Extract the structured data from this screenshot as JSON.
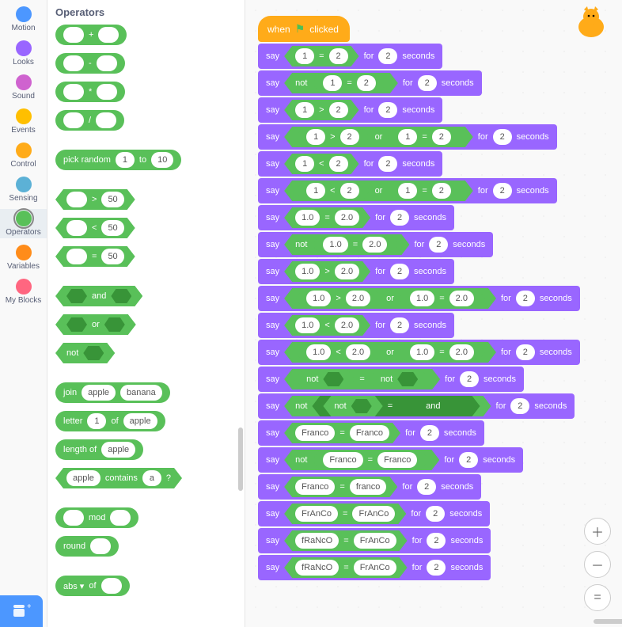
{
  "categories": [
    {
      "name": "Motion",
      "color": "#4c97ff"
    },
    {
      "name": "Looks",
      "color": "#9966ff"
    },
    {
      "name": "Sound",
      "color": "#cf63cf"
    },
    {
      "name": "Events",
      "color": "#ffbf00"
    },
    {
      "name": "Control",
      "color": "#ffab19"
    },
    {
      "name": "Sensing",
      "color": "#5cb1d6"
    },
    {
      "name": "Operators",
      "color": "#59c059",
      "selected": true
    },
    {
      "name": "Variables",
      "color": "#ff8c1a"
    },
    {
      "name": "My Blocks",
      "color": "#ff6680"
    }
  ],
  "palette_title": "Operators",
  "symbols": {
    "plus": "+",
    "minus": "-",
    "times": "*",
    "div": "/",
    "gt": ">",
    "lt": "<",
    "eq": "="
  },
  "palette": {
    "pick_random": "pick random",
    "to": "to",
    "rand_a": "1",
    "rand_b": "10",
    "cmp_val": "50",
    "and": "and",
    "or": "or",
    "not": "not",
    "join": "join",
    "j_a": "apple",
    "j_b": "banana",
    "letter": "letter",
    "let_n": "1",
    "of": "of",
    "let_s": "apple",
    "length_of": "length of",
    "len_s": "apple",
    "contains": "contains",
    "cont_s": "apple",
    "cont_c": "a",
    "q": "?",
    "mod": "mod",
    "round": "round",
    "abs": "abs ▾"
  },
  "hat": {
    "when": "when",
    "clicked": "clicked"
  },
  "say": "say",
  "for": "for",
  "seconds": "seconds",
  "secs": "2",
  "rows": [
    {
      "kind": "eq",
      "a": "1",
      "b": "2"
    },
    {
      "kind": "noteq",
      "a": "1",
      "b": "2"
    },
    {
      "kind": "gt",
      "a": "1",
      "b": "2"
    },
    {
      "kind": "or2",
      "op1": "gt",
      "a1": "1",
      "b1": "2",
      "op2": "eq",
      "a2": "1",
      "b2": "2"
    },
    {
      "kind": "lt",
      "a": "1",
      "b": "2"
    },
    {
      "kind": "or2",
      "op1": "lt",
      "a1": "1",
      "b1": "2",
      "op2": "eq",
      "a2": "1",
      "b2": "2"
    },
    {
      "kind": "eq",
      "a": "1.0",
      "b": "2.0"
    },
    {
      "kind": "noteq",
      "a": "1.0",
      "b": "2.0"
    },
    {
      "kind": "gt",
      "a": "1.0",
      "b": "2.0"
    },
    {
      "kind": "or2",
      "op1": "gt",
      "a1": "1.0",
      "b1": "2.0",
      "op2": "eq",
      "a2": "1.0",
      "b2": "2.0"
    },
    {
      "kind": "lt",
      "a": "1.0",
      "b": "2.0"
    },
    {
      "kind": "or2",
      "op1": "lt",
      "a1": "1.0",
      "b1": "2.0",
      "op2": "eq",
      "a2": "1.0",
      "b2": "2.0"
    },
    {
      "kind": "notnot"
    },
    {
      "kind": "notnotand"
    },
    {
      "kind": "eq",
      "a": "Franco",
      "b": "Franco"
    },
    {
      "kind": "noteq",
      "a": "Franco",
      "b": "Franco"
    },
    {
      "kind": "eq",
      "a": "Franco",
      "b": "franco"
    },
    {
      "kind": "eq",
      "a": "FrAnCo",
      "b": "FrAnCo"
    },
    {
      "kind": "eq",
      "a": "fRaNcO",
      "b": "FrAnCo"
    },
    {
      "kind": "eq",
      "a": "fRaNcO",
      "b": "FrAnCo"
    }
  ]
}
